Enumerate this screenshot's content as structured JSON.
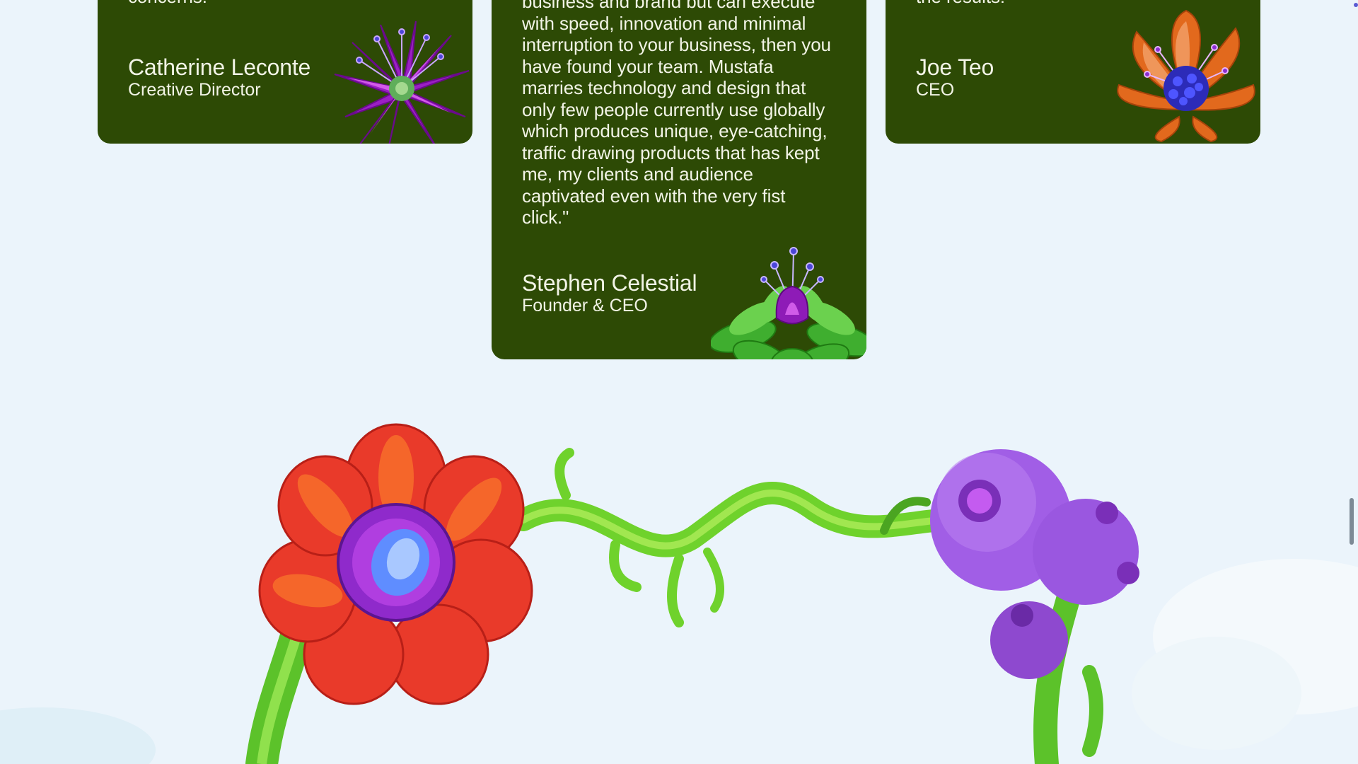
{
  "testimonials": [
    {
      "quote_tail": "concerns.",
      "name": "Catherine Leconte",
      "role": "Creative Director",
      "flower_icon": "purple-spiky-flower-icon"
    },
    {
      "quote_lines": [
        "business and brand but can execute",
        "with speed, innovation and minimal",
        "interruption to your business, then you",
        "have found your team. Mustafa",
        "marries technology and design that",
        "only few people currently use globally",
        "which produces unique, eye-catching,",
        "traffic drawing products that has kept",
        "me, my clients and audience",
        "captivated even with the very fist",
        "click.\""
      ],
      "name": "Stephen Celestial",
      "role": "Founder & CEO",
      "flower_icon": "succulent-flower-icon"
    },
    {
      "quote_tail": "the results!",
      "name": "Joe Teo",
      "role": "CEO",
      "flower_icon": "orange-tulip-flower-icon"
    }
  ],
  "decoration": {
    "garland_icon": "flower-vine-garland-icon"
  },
  "colors": {
    "background": "#ebf4fb",
    "card": "#2d4a05",
    "card_text": "#f2f4e6"
  }
}
